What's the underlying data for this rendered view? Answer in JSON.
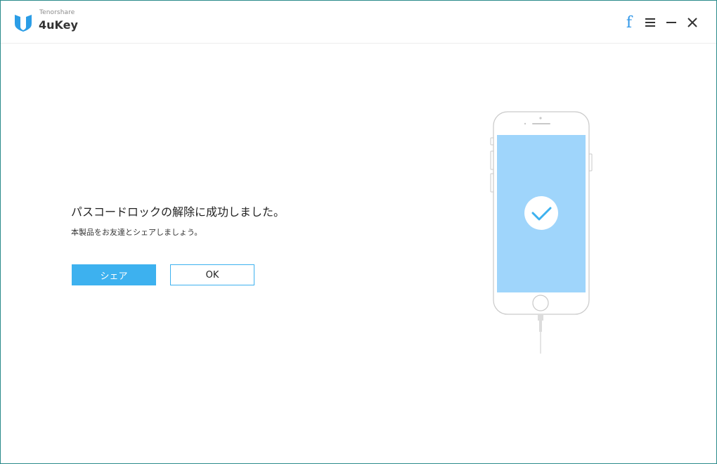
{
  "app": {
    "brand_small": "Tenorshare",
    "brand_name": "4uKey"
  },
  "titlebar": {
    "facebook_label": "f",
    "icons": [
      "facebook-icon",
      "menu-icon",
      "minimize-icon",
      "close-icon"
    ]
  },
  "main": {
    "message": "パスコードロックの解除に成功しました。",
    "sub_message": "本製品をお友達とシェアしましょう。",
    "share_label": "シェア",
    "ok_label": "OK"
  },
  "colors": {
    "accent": "#3db1ef",
    "screen": "#9fd5fb",
    "border": "#2a8a8a",
    "facebook": "#2f96e8"
  }
}
